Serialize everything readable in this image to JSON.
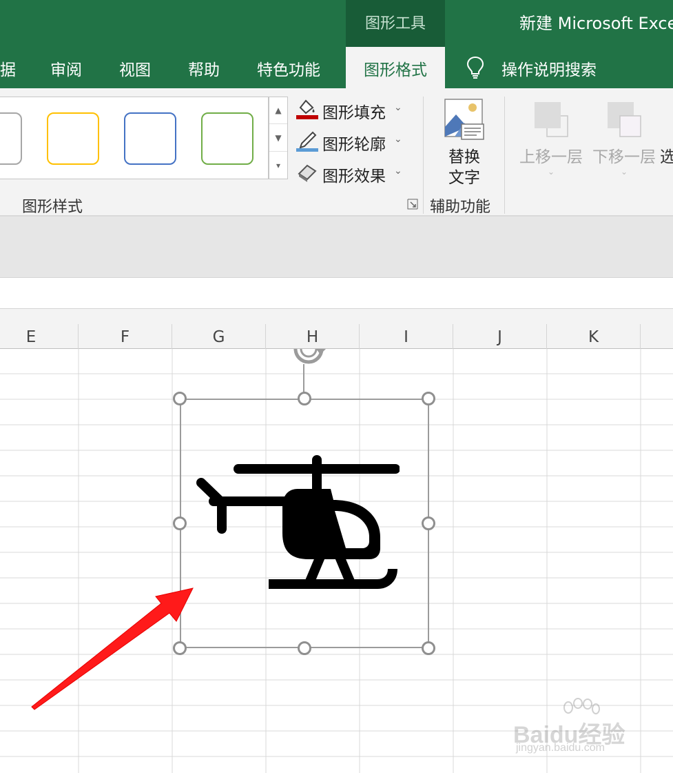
{
  "window": {
    "title": "新建 Microsoft Exce",
    "contextual_tab_group": "图形工具"
  },
  "ribbon_tabs": {
    "items": [
      {
        "label": "据"
      },
      {
        "label": "审阅"
      },
      {
        "label": "视图"
      },
      {
        "label": "帮助"
      },
      {
        "label": "特色功能"
      }
    ],
    "active": "图形格式",
    "tell_me": "操作说明搜索"
  },
  "shape_styles": {
    "group_label": "图形样式",
    "swatch_colors": [
      "#a6a6a6",
      "#ffc000",
      "#4472c4",
      "#70ad47"
    ],
    "fill": "图形填充",
    "outline": "图形轮廓",
    "effects": "图形效果",
    "fill_color": "#c00000",
    "outline_color": "#5b9bd5"
  },
  "accessibility": {
    "alt_text_line1": "替换",
    "alt_text_line2": "文字",
    "group_label": "辅助功能"
  },
  "arrange": {
    "bring_forward": "上移一层",
    "send_backward": "下移一层",
    "selection_pane": "选"
  },
  "columns": [
    "E",
    "F",
    "G",
    "H",
    "I",
    "J",
    "K"
  ],
  "watermark": {
    "logo": "Baidu经验",
    "url": "jingyan.baidu.com"
  }
}
